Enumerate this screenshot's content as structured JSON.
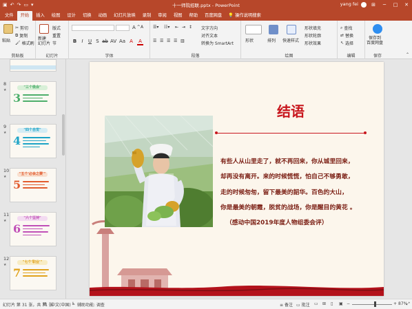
{
  "window": {
    "title": "十一师院招联.pptx  -  PowerPoint",
    "user": "yang fei",
    "controls": [
      "─",
      "□",
      "✕"
    ]
  },
  "tabs": [
    "文件",
    "开始",
    "插入",
    "绘图",
    "设计",
    "切换",
    "动画",
    "幻灯片放映",
    "录制",
    "审阅",
    "视图",
    "帮助",
    "百度网盘"
  ],
  "active_tab": "开始",
  "tell_me": "操作说明搜索",
  "ribbon": {
    "clipboard": {
      "paste": "粘贴",
      "cut": "剪切",
      "copy": "复制",
      "format_painter": "格式刷",
      "label": "剪贴板"
    },
    "slides": {
      "new": "新建\n幻灯片",
      "layout": "版式",
      "reset": "重置",
      "section": "节",
      "label": "幻灯片"
    },
    "font": {
      "label": "字体",
      "buttons": [
        "B",
        "I",
        "U",
        "S",
        "ab",
        "AV",
        "Aa",
        "A",
        "A"
      ]
    },
    "paragraph": {
      "label": "段落",
      "text_direction": "文字方向",
      "align_text": "对齐文本",
      "smartart": "转换为 SmartArt"
    },
    "drawing": {
      "shapes": "形状",
      "arrange": "排列",
      "quick_styles": "快速样式",
      "fill": "形状填充",
      "outline": "形状轮廓",
      "effects": "形状效果",
      "label": "绘图"
    },
    "editing": {
      "find": "查找",
      "replace": "替换",
      "select": "选择",
      "label": "编辑"
    },
    "save": {
      "baidu": "保存到\n百度网盘",
      "label": "保存"
    }
  },
  "thumbnails": [
    {
      "num": "8",
      "title": "\"三个微会\"",
      "big": "3",
      "accent": "#4cae6a",
      "band": "#d9f0d8"
    },
    {
      "num": "9",
      "title": "\"四个自觉\"",
      "big": "4",
      "accent": "#1ba3c6",
      "band": "#d4ecf4"
    },
    {
      "num": "10",
      "title": "\"五个'必会之赛'\"",
      "big": "5",
      "accent": "#e25b2e",
      "band": "#f9e0cf"
    },
    {
      "num": "11",
      "title": "\"六个坚持\"",
      "big": "6",
      "accent": "#c04fb7",
      "band": "#f3dbf1"
    },
    {
      "num": "12",
      "title": "\"七个'职业'\"",
      "big": "7",
      "accent": "#e1a21a",
      "band": "#f8ecc4"
    }
  ],
  "slide": {
    "title": "结语",
    "body": [
      "有些人从山里走了，就不再回来，你从城里回来，",
      "却再没有离开。来的时候慌慌，怕自己不够勇敢，",
      "走的时候匆匆，留下最美的韶华。百色的大山，",
      "你是最美的朝霞，脱贫的战场，你是醒目的黄花 。",
      "（感动中国2019年度人物组委会评）"
    ],
    "accent_color": "#c8161d",
    "text_color": "#7a1d12"
  },
  "statusbar": {
    "slide_info": "幻灯片 第 31 张，共 31 张",
    "language": "中文(中国)",
    "accessibility": "辅助功能: 调查",
    "notes": "备注",
    "comments": "批注",
    "zoom": "87%"
  }
}
